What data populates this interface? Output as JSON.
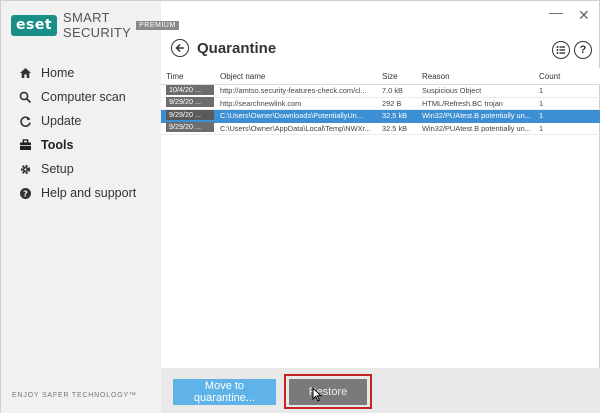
{
  "brand": {
    "badge": "eset",
    "product": "SMART SECURITY",
    "edition": "PREMIUM",
    "tagline": "ENJOY SAFER TECHNOLOGY™",
    "accent_color": "#1a8f8a"
  },
  "window_controls": {
    "minimize": "—",
    "close": "✕"
  },
  "sidebar": {
    "items": [
      {
        "label": "Home",
        "icon": "home-icon",
        "active": false
      },
      {
        "label": "Computer scan",
        "icon": "search-icon",
        "active": false
      },
      {
        "label": "Update",
        "icon": "refresh-icon",
        "active": false
      },
      {
        "label": "Tools",
        "icon": "briefcase-icon",
        "active": true
      },
      {
        "label": "Setup",
        "icon": "gear-icon",
        "active": false
      },
      {
        "label": "Help and support",
        "icon": "help-icon",
        "active": false
      }
    ]
  },
  "header": {
    "title": "Quarantine",
    "back_icon": "back-arrow-icon",
    "list_icon": "list-icon",
    "help_icon": "help-circle-icon",
    "help_glyph": "?"
  },
  "table": {
    "columns": [
      "Time",
      "Object name",
      "Size",
      "Reason",
      "Count"
    ],
    "rows": [
      {
        "time": "10/4/20 ...",
        "object": "http://amtso.security-features-check.com/cl...",
        "size": "7.0 kB",
        "reason": "Suspicious Object",
        "count": "1",
        "selected": false
      },
      {
        "time": "9/29/20 ...",
        "object": "http://searchnewlink.com",
        "size": "292 B",
        "reason": "HTML/Refresh.BC trojan",
        "count": "1",
        "selected": false
      },
      {
        "time": "9/29/20 ...",
        "object": "C:\\Users\\Owner\\Downloads\\PotentiallyUn...",
        "size": "32.5 kB",
        "reason": "Win32/PUAtest.B potentially un...",
        "count": "1",
        "selected": true
      },
      {
        "time": "9/29/20 ...",
        "object": "C:\\Users\\Owner\\AppData\\Local\\Temp\\NWXr...",
        "size": "32.5 kB",
        "reason": "Win32/PUAtest.B potentially un...",
        "count": "1",
        "selected": false
      }
    ],
    "selected_color": "#3d8fd4"
  },
  "buttons": {
    "move_to_quarantine": "Move to quarantine...",
    "restore": "Restore"
  }
}
